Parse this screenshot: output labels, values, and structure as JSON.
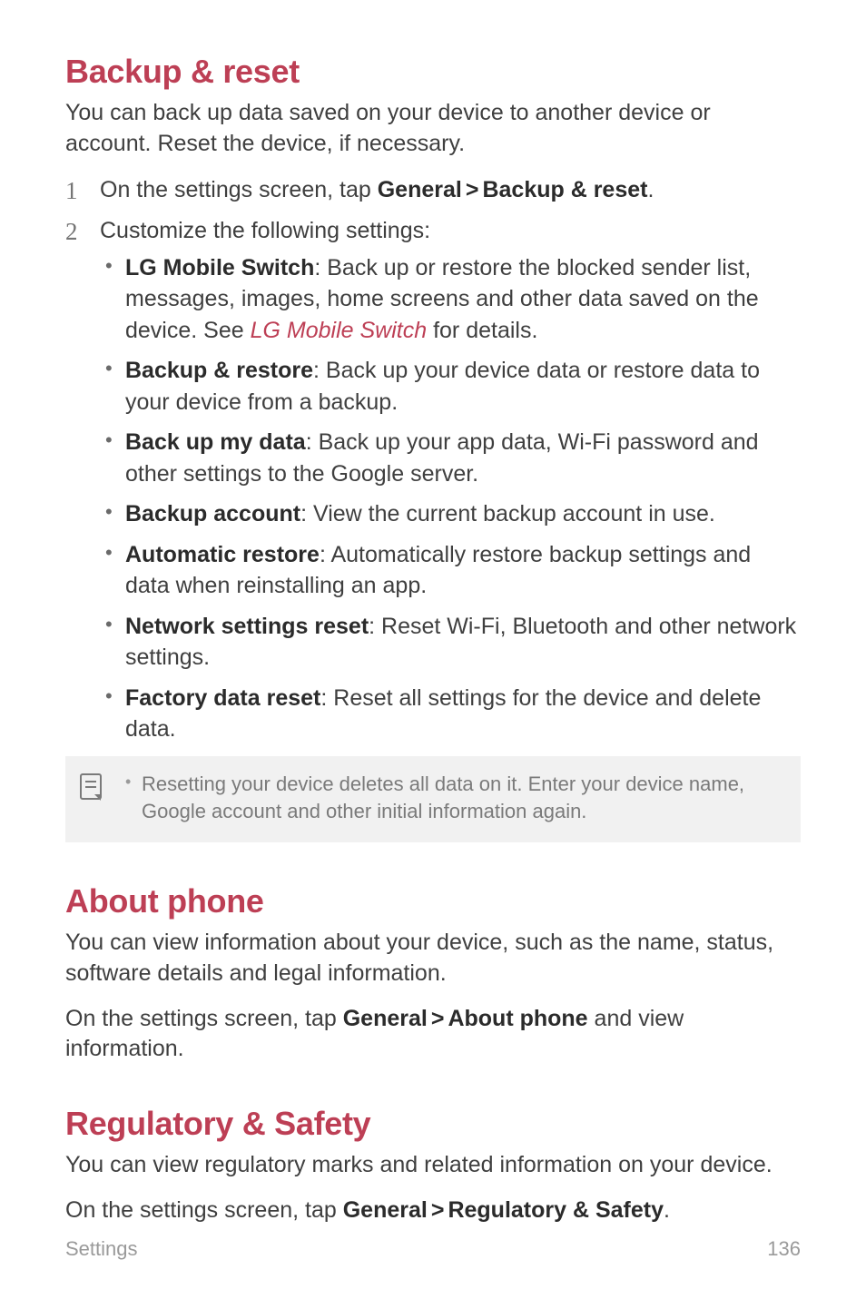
{
  "section1": {
    "title": "Backup & reset",
    "intro": "You can back up data saved on your device to another device or account. Reset the device, if necessary.",
    "step1_pre": "On the settings screen, tap ",
    "step1_b1": "General",
    "step1_b2": "Backup & reset",
    "step1_post": ".",
    "step2": "Customize the following settings:",
    "bullets": {
      "b1_label": "LG Mobile Switch",
      "b1_text_pre": ": Back up or restore the blocked sender list, messages, images, home screens and other data saved on the device. See ",
      "b1_link": "LG Mobile Switch",
      "b1_text_post": " for details.",
      "b2_label": "Backup & restore",
      "b2_text": ": Back up your device data or restore data to your device from a backup.",
      "b3_label": "Back up my data",
      "b3_text": ": Back up your app data, Wi-Fi password and other settings to the Google server.",
      "b4_label": "Backup account",
      "b4_text": ": View the current backup account in use.",
      "b5_label": "Automatic restore",
      "b5_text": ": Automatically restore backup settings and data when reinstalling an app.",
      "b6_label": "Network settings reset",
      "b6_text": ": Reset Wi-Fi, Bluetooth and other network settings.",
      "b7_label": "Factory data reset",
      "b7_text": ": Reset all settings for the device and delete data."
    },
    "note": "Resetting your device deletes all data on it. Enter your device name, Google account and other initial information again."
  },
  "section2": {
    "title": "About phone",
    "intro": "You can view information about your device, such as the name, status, software details and legal information.",
    "line_pre": "On the settings screen, tap ",
    "line_b1": "General",
    "line_b2": "About phone",
    "line_post": " and view information."
  },
  "section3": {
    "title": "Regulatory & Safety",
    "intro": "You can view regulatory marks and related information on your device.",
    "line_pre": "On the settings screen, tap ",
    "line_b1": "General",
    "line_b2": "Regulatory & Safety",
    "line_post": "."
  },
  "footer": {
    "left": "Settings",
    "right": "136"
  },
  "gt": ">"
}
